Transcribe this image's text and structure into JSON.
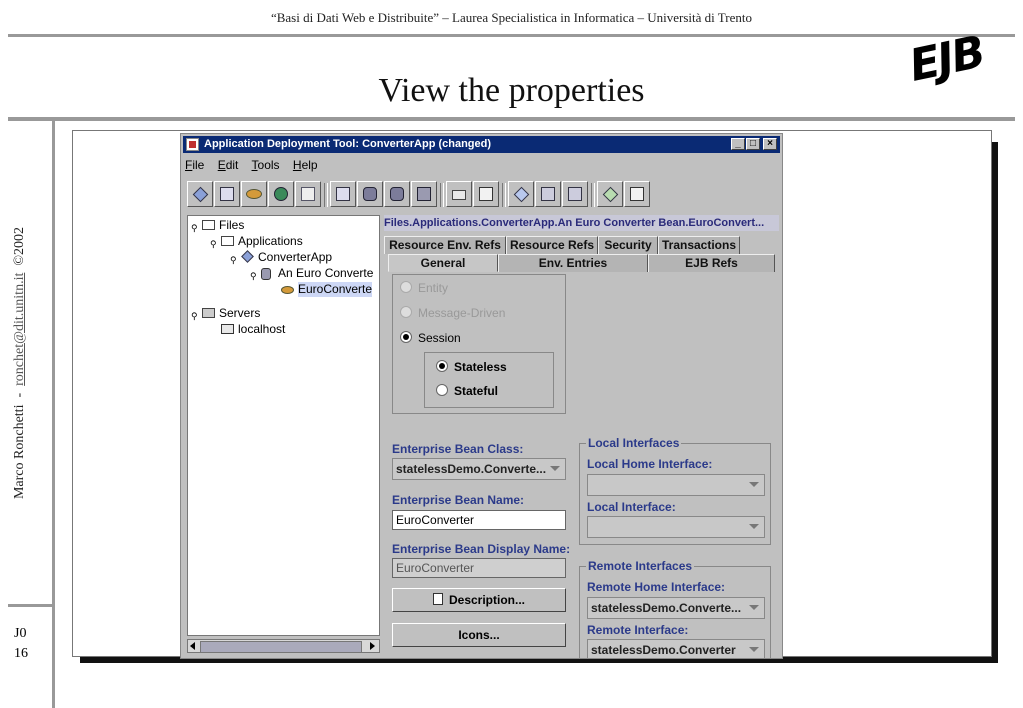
{
  "slide": {
    "header": "“Basi di Dati Web e Distribuite” – Laurea Specialistica in Informatica – Università di Trento",
    "title": "View the properties",
    "logo": "EJB",
    "side_author": "Marco Ronchetti",
    "side_sep": "-",
    "side_email": "ronchet@dit.unitn.it",
    "side_copyright": "©2002",
    "footer_code": "J0",
    "footer_page": "16"
  },
  "window": {
    "title": "Application Deployment Tool: ConverterApp (changed)",
    "minimize": "_",
    "maximize": "□",
    "close": "×"
  },
  "menu": [
    {
      "key": "F",
      "rest": "ile"
    },
    {
      "key": "E",
      "rest": "dit"
    },
    {
      "key": "T",
      "rest": "ools"
    },
    {
      "key": "H",
      "rest": "elp"
    }
  ],
  "toolbar_icons": [
    "new-application-icon",
    "new-ejb-icon",
    "new-web-component-icon",
    "new-app-client-icon",
    "add-server-icon",
    "new-resource-icon",
    "new-bean-icon",
    "new-entity-icon",
    "new-session-icon",
    "open-folder-icon",
    "save-icon",
    "deploy-icon",
    "verify-icon",
    "update-icon",
    "check-icon",
    "tools-icon"
  ],
  "tree": {
    "files": "Files",
    "applications": "Applications",
    "app": "ConverterApp",
    "jar": "An Euro Converte",
    "bean": "EuroConverte",
    "servers": "Servers",
    "host": "localhost"
  },
  "panel": {
    "path": "Files.Applications.ConverterApp.An Euro Converter Bean.EuroConvert...",
    "tabs_row1": [
      "Resource Env. Refs",
      "Resource Refs",
      "Security",
      "Transactions"
    ],
    "tabs_row2": [
      "General",
      "Env. Entries",
      "EJB Refs"
    ],
    "selected_tab": "General",
    "bean_type": {
      "entity": "Entity",
      "message_driven": "Message-Driven",
      "session": "Session",
      "selected": "Session",
      "stateless": "Stateless",
      "stateful": "Stateful",
      "session_kind": "Stateless"
    },
    "class_label": "Enterprise Bean Class:",
    "class_value": "statelessDemo.Converte...",
    "name_label": "Enterprise Bean Name:",
    "name_value": "EuroConverter",
    "display_label": "Enterprise Bean Display Name:",
    "display_value": "EuroConverter",
    "description_button": "Description...",
    "icons_button": "Icons...",
    "local": {
      "group": "Local Interfaces",
      "home_label": "Local Home Interface:",
      "home_value": "",
      "iface_label": "Local Interface:",
      "iface_value": ""
    },
    "remote": {
      "group": "Remote Interfaces",
      "home_label": "Remote Home Interface:",
      "home_value": "statelessDemo.Converte...",
      "iface_label": "Remote Interface:",
      "iface_value": "statelessDemo.Converter"
    }
  },
  "colors": {
    "titlebar": "#0a2a74",
    "label_blue": "#2b3a8a",
    "window_gray": "#c0c0c0",
    "tree_selection": "#cdd7f5"
  }
}
